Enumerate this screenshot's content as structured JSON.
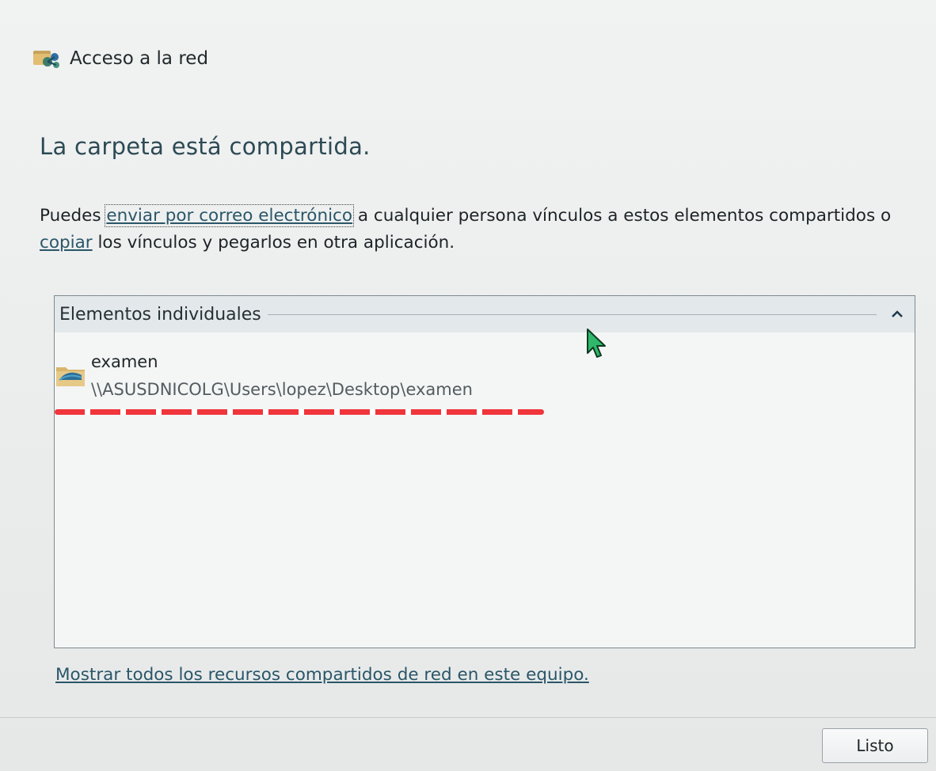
{
  "window": {
    "title": "Acceso a la red",
    "icon": "network-share-icon"
  },
  "heading": "La carpeta está compartida.",
  "description": {
    "prefix": "Puedes ",
    "email_link": "enviar por correo electrónico",
    "middle": " a cualquier persona vínculos a estos elementos compartidos o ",
    "copy_link": "copiar",
    "suffix": " los vínculos y pegarlos en otra aplicación."
  },
  "items_group": {
    "title": "Elementos individuales",
    "collapse_icon": "chevron-up-icon",
    "items": [
      {
        "name": "examen",
        "path": "\\\\ASUSDNICOLG\\Users\\lopez\\Desktop\\examen",
        "icon": "shared-folder-icon"
      }
    ]
  },
  "show_all_link": "Mostrar todos los recursos compartidos de red en este equipo.",
  "done_button": "Listo",
  "colors": {
    "link": "#2a5668",
    "heading": "#2c4a54",
    "redaction_mark": "#f0353b",
    "cursor": "#2fb86a"
  }
}
